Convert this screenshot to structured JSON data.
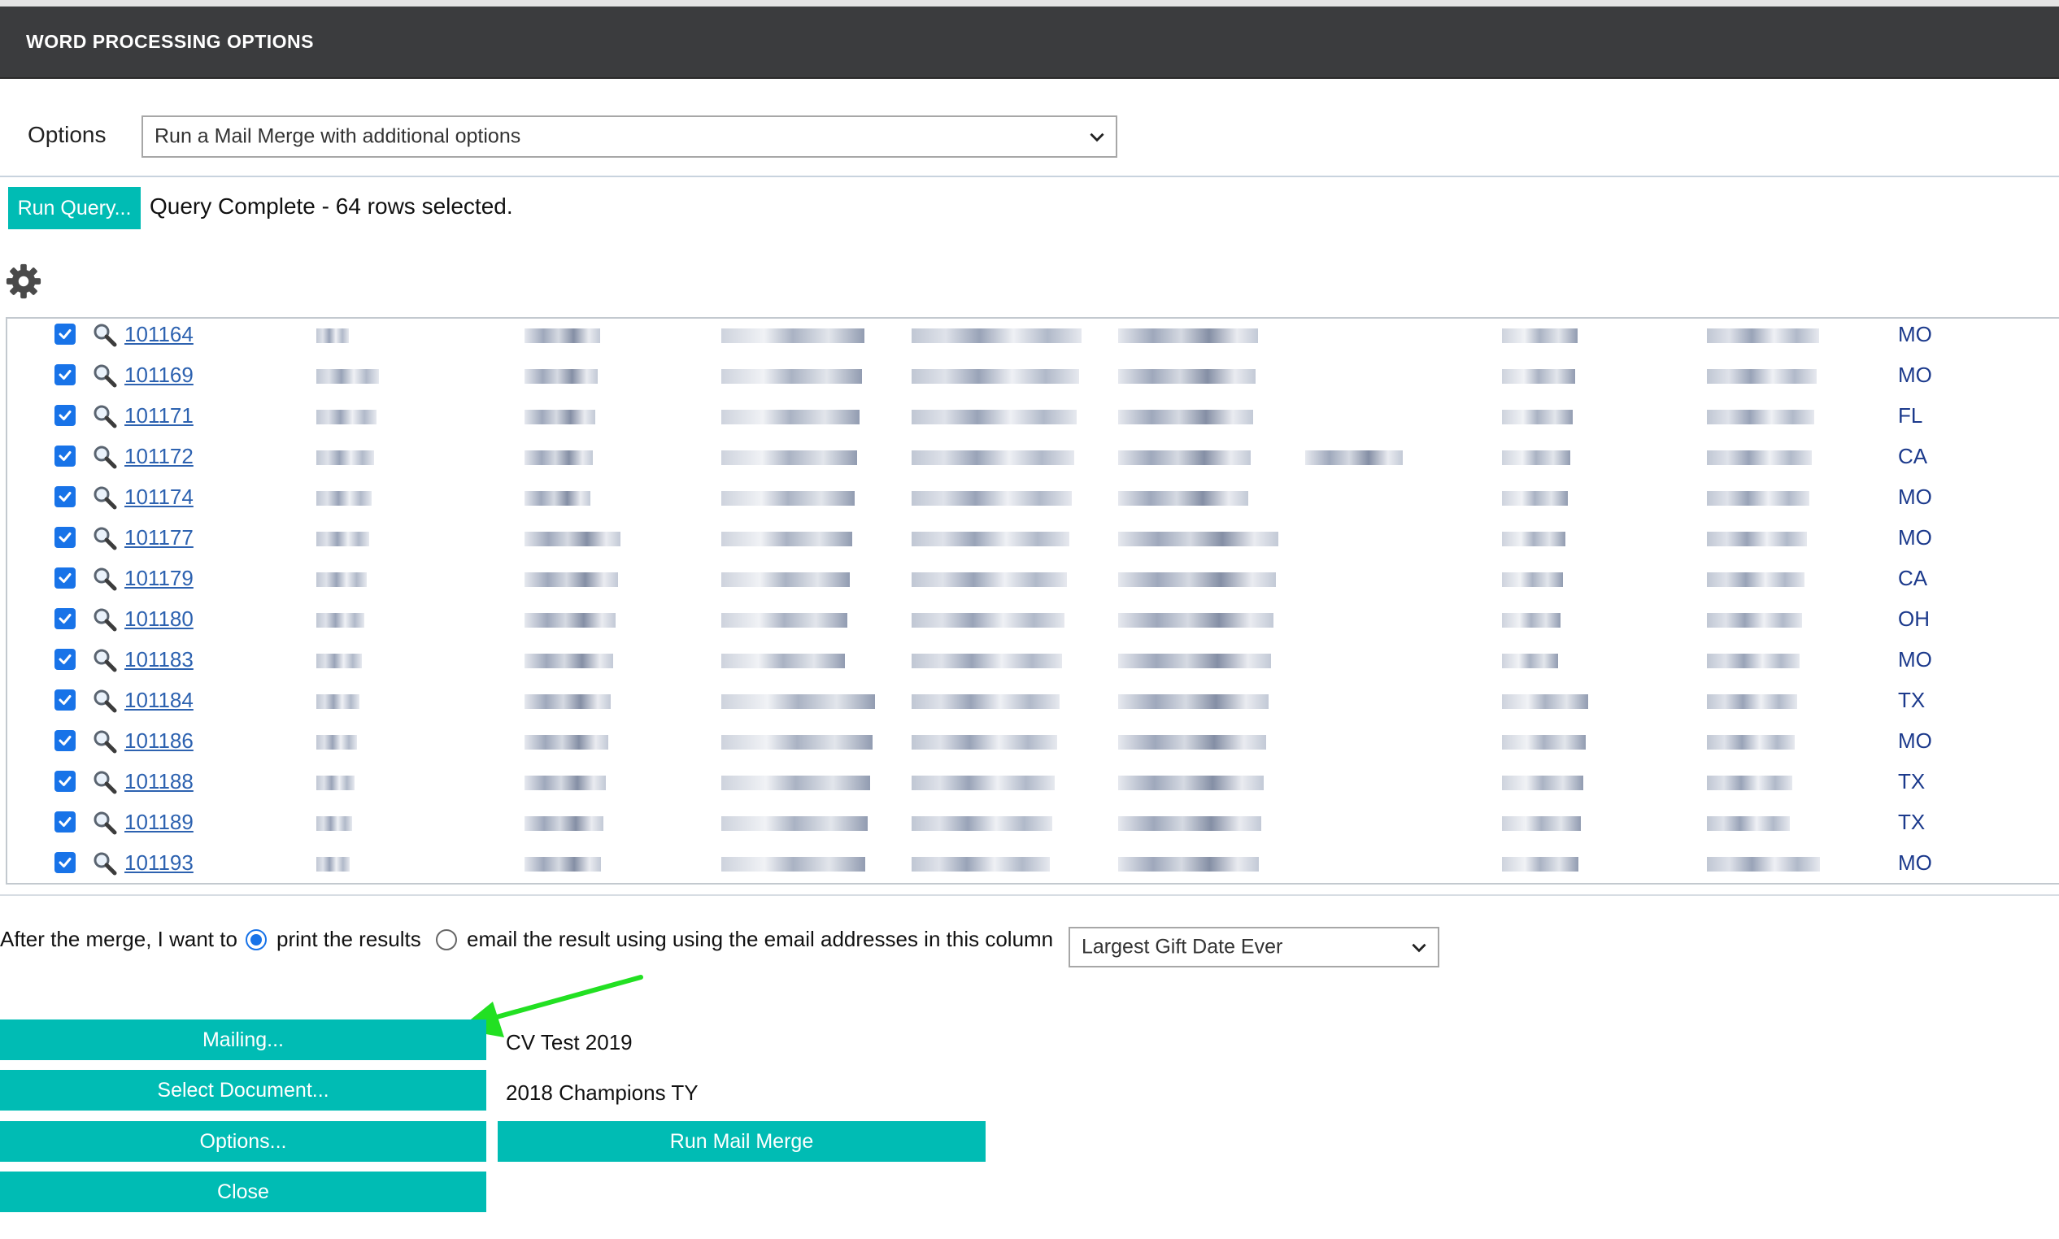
{
  "header": {
    "title": "WORD PROCESSING OPTIONS"
  },
  "options": {
    "label": "Options",
    "selected": "Run a Mail Merge with additional options"
  },
  "query": {
    "button_label": "Run Query...",
    "status": "Query Complete - 64 rows selected."
  },
  "rows": [
    {
      "id": "101164",
      "state": "MO"
    },
    {
      "id": "101169",
      "state": "MO"
    },
    {
      "id": "101171",
      "state": "FL"
    },
    {
      "id": "101172",
      "state": "CA"
    },
    {
      "id": "101174",
      "state": "MO"
    },
    {
      "id": "101177",
      "state": "MO"
    },
    {
      "id": "101179",
      "state": "CA"
    },
    {
      "id": "101180",
      "state": "OH"
    },
    {
      "id": "101183",
      "state": "MO"
    },
    {
      "id": "101184",
      "state": "TX"
    },
    {
      "id": "101186",
      "state": "MO"
    },
    {
      "id": "101188",
      "state": "TX"
    },
    {
      "id": "101189",
      "state": "TX"
    },
    {
      "id": "101193",
      "state": "MO"
    }
  ],
  "merge": {
    "after_label": "After the merge, I want to",
    "print_label": "print the results",
    "email_label": "email the result using using the email addresses in this column",
    "email_column": "Largest Gift Date Ever"
  },
  "actions": {
    "mailing_label": "Mailing...",
    "mailing_value": "CV Test 2019",
    "select_doc_label": "Select Document...",
    "select_doc_value": "2018 Champions TY",
    "options_label": "Options...",
    "run_label": "Run Mail Merge",
    "close_label": "Close"
  },
  "colors": {
    "accent": "#00bcb4",
    "header_bg": "#3b3c3e",
    "link": "#2d62b0",
    "checkbox": "#1873e8",
    "arrow": "#22e022"
  },
  "icons": {
    "settings": "gear-icon",
    "row_view": "magnifier-icon",
    "dropdown": "chevron-down-icon"
  }
}
